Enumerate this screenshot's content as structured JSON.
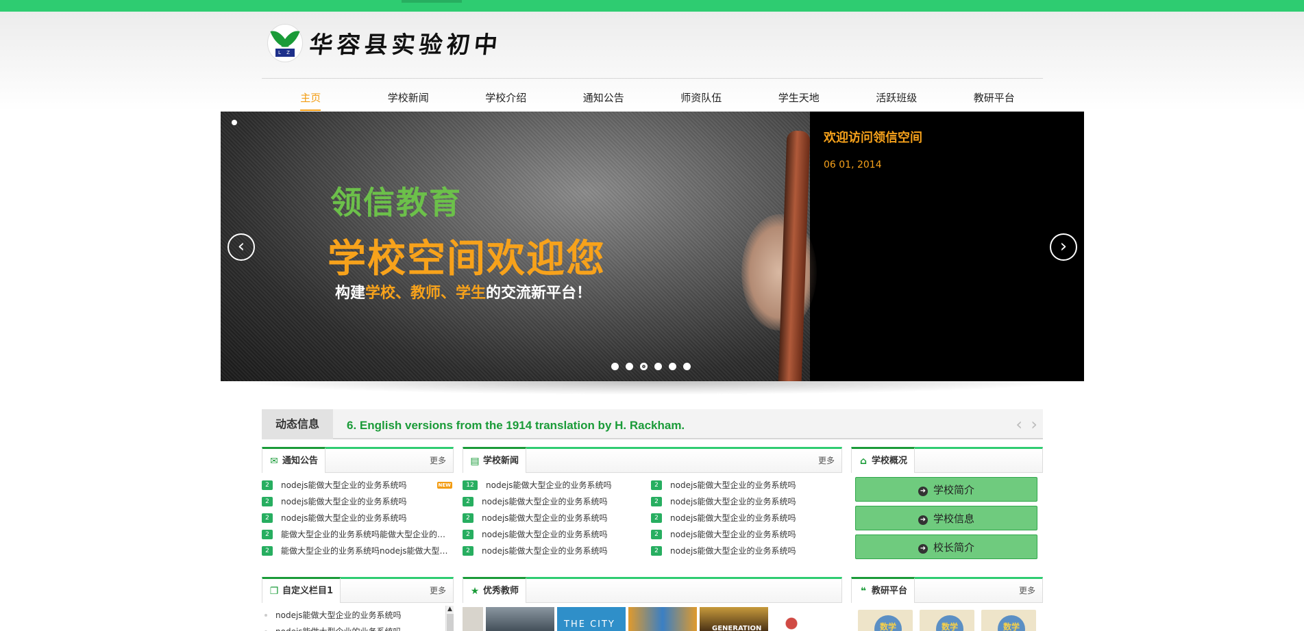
{
  "school": {
    "name": "华容县实验初中",
    "logo_letters": "L Z"
  },
  "nav": [
    {
      "label": "主页",
      "active": true
    },
    {
      "label": "学校新闻"
    },
    {
      "label": "学校介绍"
    },
    {
      "label": "通知公告"
    },
    {
      "label": "师资队伍"
    },
    {
      "label": "学生天地"
    },
    {
      "label": "活跃班级"
    },
    {
      "label": "教研平台"
    }
  ],
  "slider": {
    "line1": "领信教育",
    "line2": "学校空间欢迎您",
    "line3_prefix": "构建",
    "line3_hl1": "学校、教师、学生",
    "line3_suffix": "的交流新平台！",
    "caption_title": "欢迎访问领信空间",
    "caption_date": "06 01, 2014",
    "prev_icon": "‹",
    "next_icon": "›",
    "dot_count": 6,
    "active_dot": 2
  },
  "ticker": {
    "label": "动态信息",
    "text": "6. English versions from the 1914 translation by H. Rackham."
  },
  "notice_panel": {
    "title": "通知公告",
    "more": "更多",
    "items": [
      {
        "badge": "2",
        "text": "nodejs能做大型企业的业务系统吗",
        "new": "NEW"
      },
      {
        "badge": "2",
        "text": "nodejs能做大型企业的业务系统吗"
      },
      {
        "badge": "2",
        "text": "nodejs能做大型企业的业务系统吗"
      },
      {
        "badge": "2",
        "text": "能做大型企业的业务系统吗能做大型企业的…"
      },
      {
        "badge": "2",
        "text": "能做大型企业的业务系统吗nodejs能做大型…"
      }
    ]
  },
  "news_panel": {
    "title": "学校新闻",
    "more": "更多",
    "col1": [
      {
        "badge": "12",
        "text": "nodejs能做大型企业的业务系统吗"
      },
      {
        "badge": "2",
        "text": "nodejs能做大型企业的业务系统吗"
      },
      {
        "badge": "2",
        "text": "nodejs能做大型企业的业务系统吗"
      },
      {
        "badge": "2",
        "text": "nodejs能做大型企业的业务系统吗"
      },
      {
        "badge": "2",
        "text": "nodejs能做大型企业的业务系统吗"
      }
    ],
    "col2": [
      {
        "badge": "2",
        "text": "nodejs能做大型企业的业务系统吗"
      },
      {
        "badge": "2",
        "text": "nodejs能做大型企业的业务系统吗"
      },
      {
        "badge": "2",
        "text": "nodejs能做大型企业的业务系统吗"
      },
      {
        "badge": "2",
        "text": "nodejs能做大型企业的业务系统吗"
      },
      {
        "badge": "2",
        "text": "nodejs能做大型企业的业务系统吗"
      }
    ]
  },
  "overview_panel": {
    "title": "学校概况",
    "buttons": [
      "学校简介",
      "学校信息",
      "校长简介"
    ]
  },
  "custom_panel": {
    "title": "自定义栏目1",
    "more": "更多",
    "items": [
      "nodejs能做大型企业的业务系统吗",
      "nodejs能做大型企业的业务系统吗"
    ]
  },
  "teacher_panel": {
    "title": "优秀教师",
    "thumb_colors": [
      "#d8d4cc",
      "#5a6670",
      "#2f8fc9",
      "#e09a2c",
      "#6b4a1e",
      "#d04a44"
    ],
    "thumb_texts": [
      "",
      "",
      "THE CITY",
      "",
      "GENERATION",
      ""
    ]
  },
  "research_panel": {
    "title": "教研平台",
    "more": "更多",
    "cards": [
      "数学",
      "数学",
      "数学"
    ]
  },
  "colors": {
    "brand_green": "#2ecc71",
    "accent_orange": "#f39c12"
  }
}
